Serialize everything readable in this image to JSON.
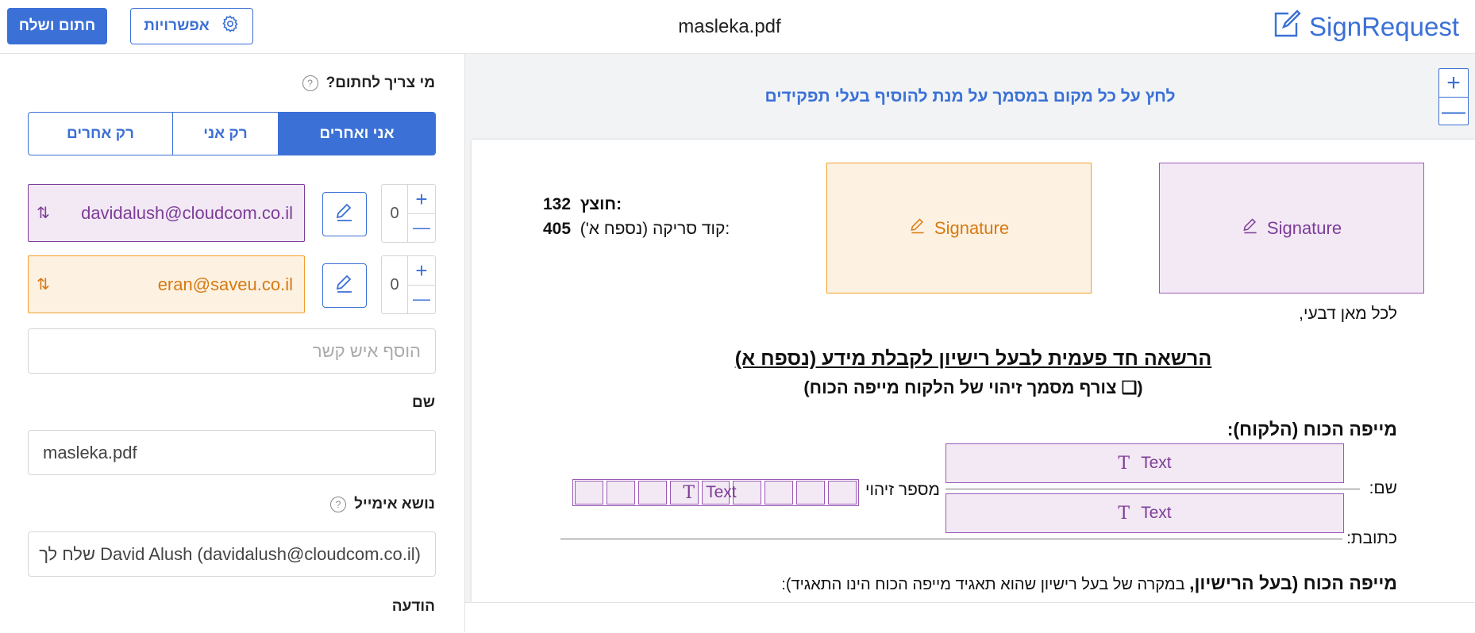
{
  "header": {
    "sign_send_label": "חתום ושלח",
    "options_label": "אפשרויות",
    "document_title": "masleka.pdf",
    "brand_name": "SignRequest",
    "accent_color": "#3b70d6"
  },
  "left_panel": {
    "who_signs_label": "מי צריך לחתום?",
    "segments": [
      "רק אחרים",
      "רק אני",
      "אני ואחרים"
    ],
    "signers": [
      {
        "email": "davidalush@cloudcom.co.il",
        "order": "0",
        "color": "#7d3c98"
      },
      {
        "email": "eran@saveu.co.il",
        "order": "0",
        "color": "#d87a10"
      }
    ],
    "add_contact_placeholder": "הוסף איש קשר",
    "name_label": "שם",
    "name_value": "masleka.pdf",
    "email_subject_label": "נושא אימייל",
    "email_subject_value": "David Alush (davidalush@cloudcom.co.il) שלח לך",
    "message_label": "הודעה"
  },
  "document": {
    "hint": "לחץ על כל מקום במסמך על מנת להוסיף בעלי תפקידים",
    "signature_label": "Signature",
    "text_label": "Text",
    "serial_label": "חוצץ:",
    "serial_value": "132",
    "scan_code_label": "קוד סריקה (נספח א'):",
    "scan_code_value": "405",
    "greeting": "לכל מאן דבעי,",
    "heading": "הרשאה חד פעמית לבעל רישיון לקבלת מידע (נספח א)",
    "subheading": "(❑ צורף מסמך זיהוי של הלקוח מייפה הכוח)",
    "grantor_label": "מייפה הכוח (הלקוח):",
    "name_field": "שם:",
    "id_field": "מספר זיהוי",
    "address_field": "כתובת:",
    "licensee_bold": "מייפה הכוח (בעל הרישיון,",
    "licensee_rest": " במקרה של בעל רישיון שהוא תאגיד מייפה הכוח הינו התאגיד):"
  }
}
